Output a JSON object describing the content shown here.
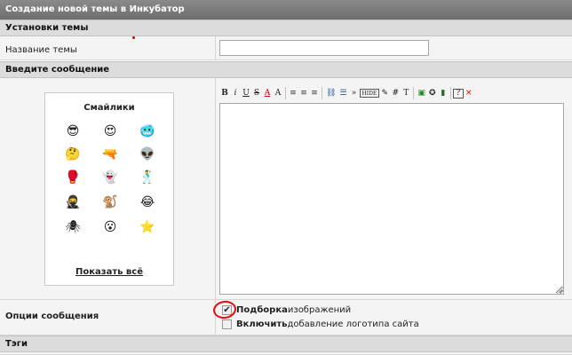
{
  "title_bar": "Создание новой темы в Инкубатор",
  "sections": {
    "settings": "Установки темы",
    "message": "Введите сообщение",
    "tags": "Тэги"
  },
  "topic": {
    "label": "Название темы",
    "value": "",
    "placeholder": ""
  },
  "smilies": {
    "title": "Смайлики",
    "show_all": "Показать всё",
    "icons": [
      {
        "name": "cool-smiley-icon",
        "glyph": "😎"
      },
      {
        "name": "love-smiley-icon",
        "glyph": "😍"
      },
      {
        "name": "blue-smiley-icon",
        "glyph": "🥶"
      },
      {
        "name": "thinking-smiley-icon",
        "glyph": "🤔"
      },
      {
        "name": "gun-smiley-icon",
        "glyph": "🔫"
      },
      {
        "name": "alien-smiley-icon",
        "glyph": "👽"
      },
      {
        "name": "fight-smiley-icon",
        "glyph": "🥊"
      },
      {
        "name": "ghost-smiley-icon",
        "glyph": "👻"
      },
      {
        "name": "dance-smiley-icon",
        "glyph": "🕺"
      },
      {
        "name": "ninja-smiley-icon",
        "glyph": "🥷"
      },
      {
        "name": "monkey-smiley-icon",
        "glyph": "🐒"
      },
      {
        "name": "laugh-smiley-icon",
        "glyph": "😂"
      },
      {
        "name": "spider-smiley-icon",
        "glyph": "🕷"
      },
      {
        "name": "yawn-smiley-icon",
        "glyph": "😮"
      },
      {
        "name": "star-smiley-icon",
        "glyph": "⭐"
      }
    ]
  },
  "toolbar": [
    {
      "name": "bold-button",
      "label": "B"
    },
    {
      "name": "italic-button",
      "label": "i"
    },
    {
      "name": "underline-button",
      "label": "U"
    },
    {
      "name": "strike-button",
      "label": "S"
    },
    {
      "name": "font-color-button",
      "label": "A"
    },
    {
      "name": "font-size-button",
      "label": "A"
    },
    {
      "name": "sep"
    },
    {
      "name": "align-left-button",
      "label": "≡"
    },
    {
      "name": "align-center-button",
      "label": "≡"
    },
    {
      "name": "align-right-button",
      "label": "≡"
    },
    {
      "name": "sep"
    },
    {
      "name": "link-button",
      "label": "⛓"
    },
    {
      "name": "list-button",
      "label": "☰"
    },
    {
      "name": "quote-button",
      "label": "»"
    },
    {
      "name": "hide-button",
      "label": "HIDE"
    },
    {
      "name": "spoiler-button",
      "label": "✎"
    },
    {
      "name": "hash-button",
      "label": "#"
    },
    {
      "name": "text-button",
      "label": "T"
    },
    {
      "name": "sep"
    },
    {
      "name": "image-button",
      "label": "▣"
    },
    {
      "name": "flash-button",
      "label": "✪"
    },
    {
      "name": "video-button",
      "label": "▮"
    },
    {
      "name": "sep"
    },
    {
      "name": "help-button",
      "label": "?"
    },
    {
      "name": "clear-button",
      "label": "×"
    }
  ],
  "options": {
    "label": "Опции сообщения",
    "items": [
      {
        "bold": "Подборка",
        "rest": " изображений",
        "checked": true
      },
      {
        "bold": "Включить",
        "rest": " добавление логотипа сайта",
        "checked": false
      }
    ]
  },
  "colors": {
    "highlight_circle": "#e01010"
  }
}
